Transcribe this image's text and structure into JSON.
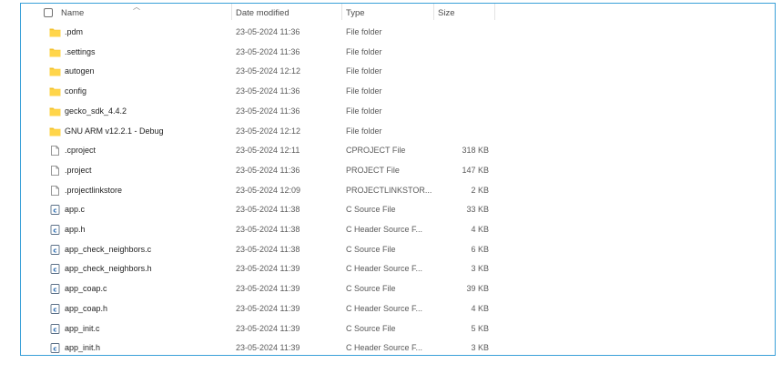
{
  "columns": {
    "name": "Name",
    "date": "Date modified",
    "type": "Type",
    "size": "Size"
  },
  "files": [
    {
      "name": ".pdm",
      "date": "23-05-2024 11:36",
      "type": "File folder",
      "size": "",
      "icon": "folder-icon"
    },
    {
      "name": ".settings",
      "date": "23-05-2024 11:36",
      "type": "File folder",
      "size": "",
      "icon": "folder-icon"
    },
    {
      "name": "autogen",
      "date": "23-05-2024 12:12",
      "type": "File folder",
      "size": "",
      "icon": "folder-icon"
    },
    {
      "name": "config",
      "date": "23-05-2024 11:36",
      "type": "File folder",
      "size": "",
      "icon": "folder-icon"
    },
    {
      "name": "gecko_sdk_4.4.2",
      "date": "23-05-2024 11:36",
      "type": "File folder",
      "size": "",
      "icon": "folder-icon"
    },
    {
      "name": "GNU ARM v12.2.1 - Debug",
      "date": "23-05-2024 12:12",
      "type": "File folder",
      "size": "",
      "icon": "folder-icon"
    },
    {
      "name": ".cproject",
      "date": "23-05-2024 12:11",
      "type": "CPROJECT File",
      "size": "318 KB",
      "icon": "file-icon"
    },
    {
      "name": ".project",
      "date": "23-05-2024 11:36",
      "type": "PROJECT File",
      "size": "147 KB",
      "icon": "file-icon"
    },
    {
      "name": ".projectlinkstore",
      "date": "23-05-2024 12:09",
      "type": "PROJECTLINKSTOR...",
      "size": "2 KB",
      "icon": "file-icon"
    },
    {
      "name": "app.c",
      "date": "23-05-2024 11:38",
      "type": "C Source File",
      "size": "33 KB",
      "icon": "c-source-icon"
    },
    {
      "name": "app.h",
      "date": "23-05-2024 11:38",
      "type": "C Header Source F...",
      "size": "4 KB",
      "icon": "c-header-icon"
    },
    {
      "name": "app_check_neighbors.c",
      "date": "23-05-2024 11:38",
      "type": "C Source File",
      "size": "6 KB",
      "icon": "c-source-icon"
    },
    {
      "name": "app_check_neighbors.h",
      "date": "23-05-2024 11:39",
      "type": "C Header Source F...",
      "size": "3 KB",
      "icon": "c-header-icon"
    },
    {
      "name": "app_coap.c",
      "date": "23-05-2024 11:39",
      "type": "C Source File",
      "size": "39 KB",
      "icon": "c-source-icon"
    },
    {
      "name": "app_coap.h",
      "date": "23-05-2024 11:39",
      "type": "C Header Source F...",
      "size": "4 KB",
      "icon": "c-header-icon"
    },
    {
      "name": "app_init.c",
      "date": "23-05-2024 11:39",
      "type": "C Source File",
      "size": "5 KB",
      "icon": "c-source-icon"
    },
    {
      "name": "app_init.h",
      "date": "23-05-2024 11:39",
      "type": "C Header Source F...",
      "size": "3 KB",
      "icon": "c-header-icon"
    }
  ]
}
